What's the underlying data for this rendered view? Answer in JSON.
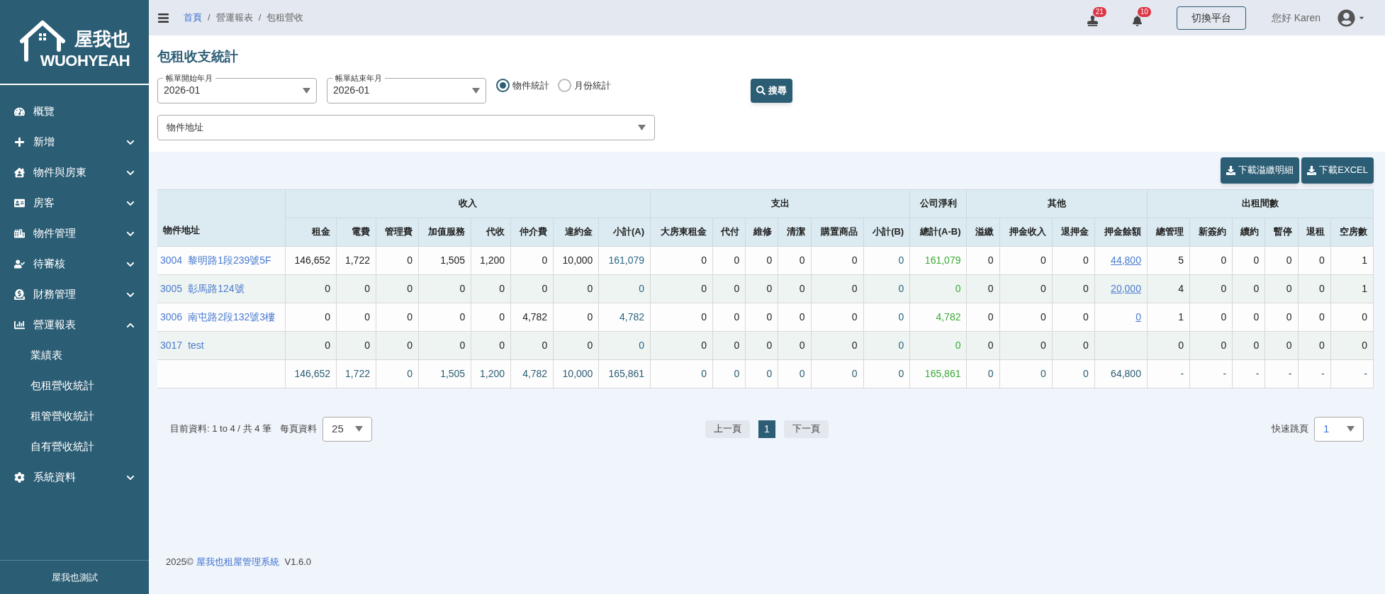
{
  "sidebar": {
    "logo": {
      "name": "屋我也",
      "wordmark": "WUOHYEAH"
    },
    "items": [
      {
        "label": "概覽"
      },
      {
        "label": "新增",
        "expanded": false
      },
      {
        "label": "物件與房東",
        "expanded": false
      },
      {
        "label": "房客",
        "expanded": false
      },
      {
        "label": "物件管理",
        "expanded": false
      },
      {
        "label": "待審核",
        "expanded": false
      },
      {
        "label": "財務管理",
        "expanded": false
      },
      {
        "label": "營運報表",
        "expanded": true,
        "children": [
          {
            "label": "業績表"
          },
          {
            "label": "包租營收統計"
          },
          {
            "label": "租管營收統計"
          },
          {
            "label": "自有營收統計"
          }
        ]
      },
      {
        "label": "系統資料",
        "expanded": false
      }
    ],
    "footer": "屋我也測試"
  },
  "topbar": {
    "breadcrumb": [
      {
        "label": "首頁",
        "link": true
      },
      {
        "label": "營運報表",
        "link": false
      },
      {
        "label": "包租營收",
        "link": false
      }
    ],
    "separator": "/",
    "notifications": [
      {
        "count": "21"
      },
      {
        "count": "10"
      }
    ],
    "switch_button": "切換平台",
    "greeting": "您好 Karen"
  },
  "filters": {
    "title": "包租收支統計",
    "start": {
      "label": "帳單開始年月",
      "value": "2026-01"
    },
    "end": {
      "label": "帳單結束年月",
      "value": "2026-01"
    },
    "modes": [
      {
        "label": "物件統計",
        "selected": true
      },
      {
        "label": "月份統計",
        "selected": false
      }
    ],
    "search_button": "搜尋",
    "address": {
      "placeholder": "物件地址"
    }
  },
  "downloads": [
    "下載溢繳明細",
    "下載EXCEL"
  ],
  "table": {
    "address_header": "物件地址",
    "groups": [
      {
        "label": "收入",
        "columns": [
          {
            "label": "租金",
            "kind": "plain"
          },
          {
            "label": "電費",
            "kind": "plain"
          },
          {
            "label": "管理費",
            "kind": "plain"
          },
          {
            "label": "加值服務",
            "kind": "plain"
          },
          {
            "label": "代收",
            "kind": "plain"
          },
          {
            "label": "仲介費",
            "kind": "plain"
          },
          {
            "label": "違約金",
            "kind": "plain"
          },
          {
            "label": "小計(A)",
            "kind": "subtotal"
          }
        ]
      },
      {
        "label": "支出",
        "columns": [
          {
            "label": "大房東租金",
            "kind": "plain"
          },
          {
            "label": "代付",
            "kind": "plain"
          },
          {
            "label": "維修",
            "kind": "plain"
          },
          {
            "label": "清潔",
            "kind": "plain"
          },
          {
            "label": "購置商品",
            "kind": "plain"
          },
          {
            "label": "小計(B)",
            "kind": "subtotal"
          }
        ]
      },
      {
        "label": "公司淨利",
        "columns": [
          {
            "label": "總計(A-B)",
            "kind": "profit"
          }
        ]
      },
      {
        "label": "其他",
        "columns": [
          {
            "label": "溢繳",
            "kind": "plain"
          },
          {
            "label": "押金收入",
            "kind": "plain"
          },
          {
            "label": "退押金",
            "kind": "plain"
          },
          {
            "label": "押金餘額",
            "kind": "deposit"
          }
        ]
      },
      {
        "label": "出租間數",
        "columns": [
          {
            "label": "總管理",
            "kind": "plain"
          },
          {
            "label": "新簽約",
            "kind": "plain"
          },
          {
            "label": "續約",
            "kind": "plain"
          },
          {
            "label": "暫停",
            "kind": "plain"
          },
          {
            "label": "退租",
            "kind": "plain"
          },
          {
            "label": "空房數",
            "kind": "plain"
          }
        ]
      }
    ],
    "rows": [
      {
        "kind": "data",
        "code": "3004",
        "name": "黎明路1段239號5F",
        "groups": [
          [
            "146,652",
            "1,722",
            "0",
            "1,505",
            "1,200",
            "0",
            "10,000",
            "161,079"
          ],
          [
            "0",
            "0",
            "0",
            "0",
            "0",
            "0"
          ],
          [
            "161,079"
          ],
          [
            "0",
            "0",
            "0",
            "44,800"
          ],
          [
            "5",
            "0",
            "0",
            "0",
            "0",
            "1"
          ]
        ]
      },
      {
        "kind": "data",
        "code": "3005",
        "name": "彰馬路124號",
        "groups": [
          [
            "0",
            "0",
            "0",
            "0",
            "0",
            "0",
            "0",
            "0"
          ],
          [
            "0",
            "0",
            "0",
            "0",
            "0",
            "0"
          ],
          [
            "0"
          ],
          [
            "0",
            "0",
            "0",
            "20,000"
          ],
          [
            "4",
            "0",
            "0",
            "0",
            "0",
            "1"
          ]
        ]
      },
      {
        "kind": "data",
        "code": "3006",
        "name": "南屯路2段132號3樓",
        "groups": [
          [
            "0",
            "0",
            "0",
            "0",
            "0",
            "4,782",
            "0",
            "4,782"
          ],
          [
            "0",
            "0",
            "0",
            "0",
            "0",
            "0"
          ],
          [
            "4,782"
          ],
          [
            "0",
            "0",
            "0",
            "0"
          ],
          [
            "1",
            "0",
            "0",
            "0",
            "0",
            "0"
          ]
        ]
      },
      {
        "kind": "data",
        "code": "3017",
        "name": "test",
        "groups": [
          [
            "0",
            "0",
            "0",
            "0",
            "0",
            "0",
            "0",
            "0"
          ],
          [
            "0",
            "0",
            "0",
            "0",
            "0",
            "0"
          ],
          [
            "0"
          ],
          [
            "0",
            "0",
            "0"
          ],
          [
            "0",
            "0",
            "0",
            "0",
            "0",
            "0"
          ]
        ]
      },
      {
        "kind": "total",
        "groups": [
          [
            "146,652",
            "1,722",
            "0",
            "1,505",
            "1,200",
            "4,782",
            "10,000",
            "165,861"
          ],
          [
            "0",
            "0",
            "0",
            "0",
            "0",
            "0"
          ],
          [
            "165,861"
          ],
          [
            "0",
            "0",
            "0",
            "64,800"
          ],
          [
            "-",
            "-",
            "-",
            "-",
            "-",
            "-"
          ]
        ]
      }
    ]
  },
  "pagination": {
    "summary": "目前資料: 1 to 4 / 共 4 筆",
    "page_size_label": "每頁資料",
    "page_size": "25",
    "prev": "上一頁",
    "pages": [
      {
        "label": "1",
        "selected": true
      }
    ],
    "next": "下一頁",
    "jump_label": "快速跳頁",
    "jump_value": "1"
  },
  "footer": {
    "year": "2025©",
    "link": "屋我也租屋管理系統",
    "version": "V1.6.0"
  }
}
